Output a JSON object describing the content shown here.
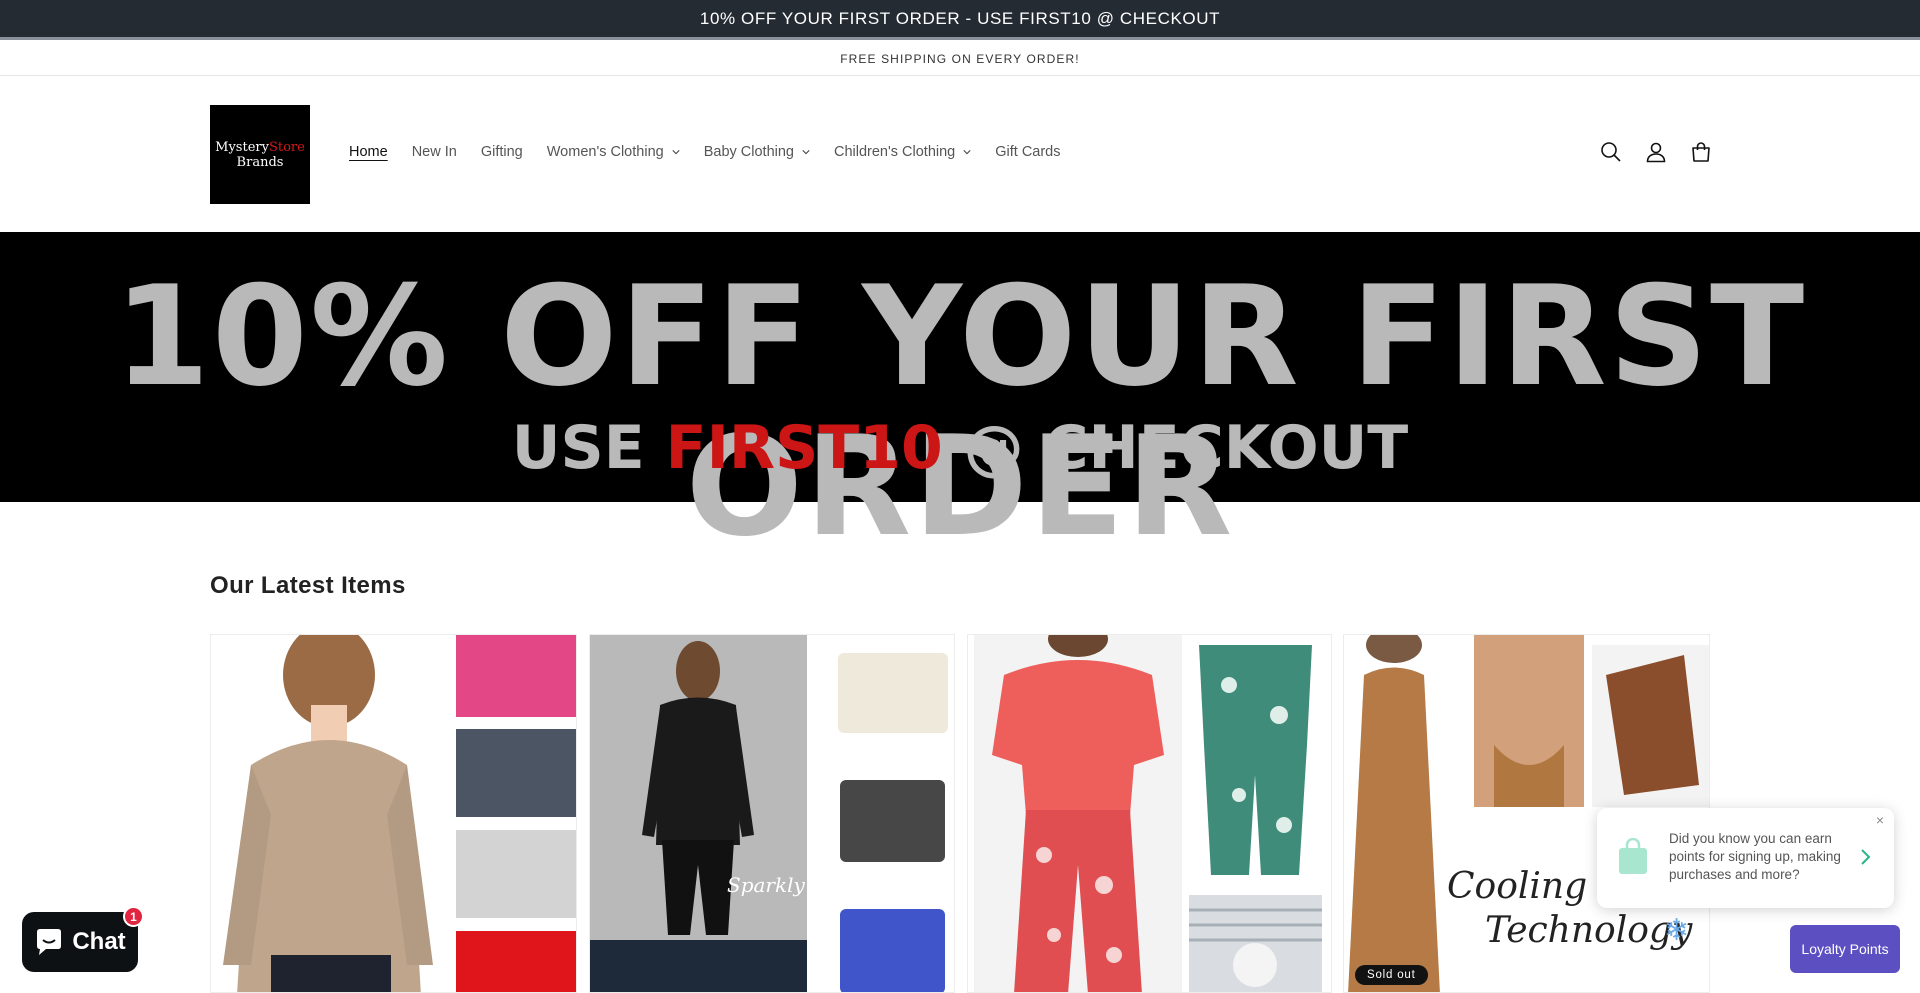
{
  "announcement": {
    "text": "10% OFF YOUR FIRST ORDER - USE FIRST10 @ CHECKOUT"
  },
  "shipping_bar": {
    "text": "FREE SHIPPING ON EVERY ORDER!"
  },
  "logo": {
    "line1_a": "Mystery",
    "line1_b": "Store",
    "line2": "Brands"
  },
  "nav": {
    "home": "Home",
    "new_in": "New In",
    "gifting": "Gifting",
    "womens": "Women's Clothing",
    "baby": "Baby Clothing",
    "childrens": "Children's Clothing",
    "gift_cards": "Gift Cards"
  },
  "header_icons": [
    "search-icon",
    "account-icon",
    "cart-icon"
  ],
  "hero": {
    "line1": "10% OFF YOUR FIRST ORDER",
    "line2_a": "USE ",
    "line2_code": "FIRST10",
    "line2_b": " @ CHECKOUT"
  },
  "latest": {
    "title": "Our Latest Items",
    "sparkly": "Sparkly",
    "cooling_line1": "Cooling C",
    "cooling_line2": "Technology",
    "sold_out": "Sold out"
  },
  "loyalty_popup": {
    "message": "Did you know you can earn points for signing up, making purchases and more?",
    "close": "×"
  },
  "loyalty_button": {
    "label": "Loyalty Points"
  },
  "chat": {
    "label": "Chat",
    "badge_count": "1"
  },
  "colors": {
    "announce_bg": "#252b33",
    "hero_text": "#b9b9b9",
    "hero_code": "#cc1515",
    "loyalty_purple": "#5b4fc2",
    "chat_badge": "#e3243e"
  }
}
